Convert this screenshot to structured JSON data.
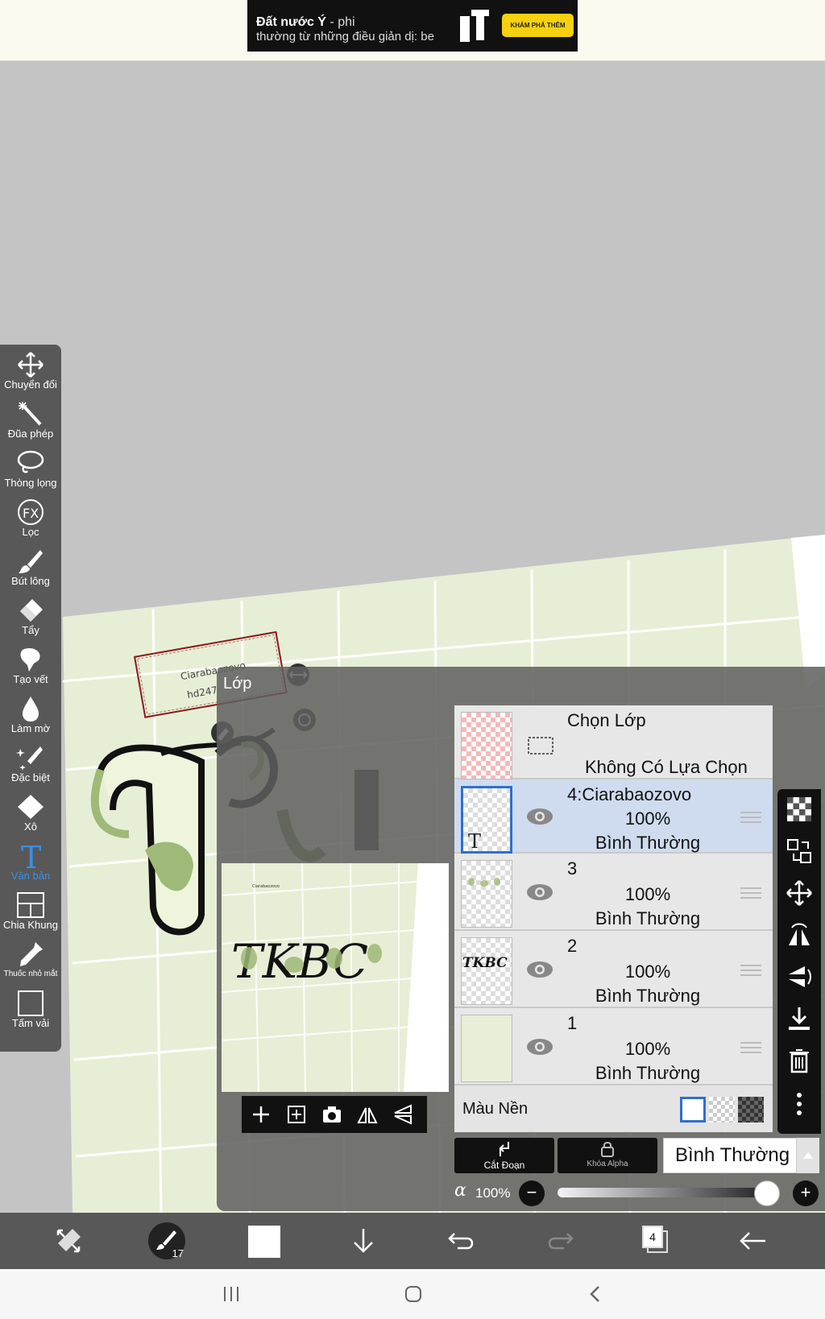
{
  "ad": {
    "line1_bold": "Đất nước Ý",
    "line1_rest": " - phi",
    "line2": "thường từ những điều giản dị: be",
    "cta": "KHÁM PHÁ THÊM"
  },
  "canvas": {
    "text_box_line1": "Ciarabaozovo",
    "text_box_line2": "hd247",
    "preview_text": "TKBC"
  },
  "toolbar": {
    "items": [
      {
        "label": "Chuyển đổi",
        "icon": "move-icon"
      },
      {
        "label": "Đũa phép",
        "icon": "magic-wand-icon"
      },
      {
        "label": "Thòng lọng",
        "icon": "lasso-icon"
      },
      {
        "label": "Lọc",
        "icon": "fx-filter-icon"
      },
      {
        "label": "Bút lông",
        "icon": "brush-icon"
      },
      {
        "label": "Tẩy",
        "icon": "eraser-icon"
      },
      {
        "label": "Tạo vết",
        "icon": "smudge-icon"
      },
      {
        "label": "Làm mờ",
        "icon": "blur-drop-icon"
      },
      {
        "label": "Đặc biệt",
        "icon": "special-brush-icon"
      },
      {
        "label": "Xô",
        "icon": "bucket-icon"
      },
      {
        "label": "Văn bản",
        "icon": "text-icon",
        "active": true
      },
      {
        "label": "Chia Khung",
        "icon": "frame-divider-icon"
      },
      {
        "label": "Thuốc nhỏ mắt",
        "icon": "eyedropper-icon"
      },
      {
        "label": "Tấm vải",
        "icon": "canvas-icon"
      }
    ]
  },
  "layer_panel": {
    "title": "Lớp",
    "selection_layer": {
      "title": "Chọn Lớp",
      "status": "Không Có Lựa Chọn"
    },
    "layers": [
      {
        "name": "4:Ciarabaozovo",
        "opacity": "100%",
        "mode": "Bình Thường",
        "selected": true
      },
      {
        "name": "3",
        "opacity": "100%",
        "mode": "Bình Thường",
        "selected": false
      },
      {
        "name": "2",
        "opacity": "100%",
        "mode": "Bình Thường",
        "selected": false
      },
      {
        "name": "1",
        "opacity": "100%",
        "mode": "Bình Thường",
        "selected": false
      }
    ],
    "background_label": "Màu Nền",
    "clipping_label": "Cắt Đoạn",
    "alpha_lock_label": "Khóa Alpha",
    "blend_mode": "Bình Thường",
    "alpha_symbol": "α",
    "alpha_value": "100%",
    "alpha_fraction": 1.0
  },
  "bottom_bar": {
    "brush_size": "17",
    "layer_count": "4",
    "color": "#ffffff"
  },
  "colors": {
    "accent_blue": "#2f6fd0",
    "toolbar_bg": "#585858",
    "selected_row": "#cfdcef"
  }
}
